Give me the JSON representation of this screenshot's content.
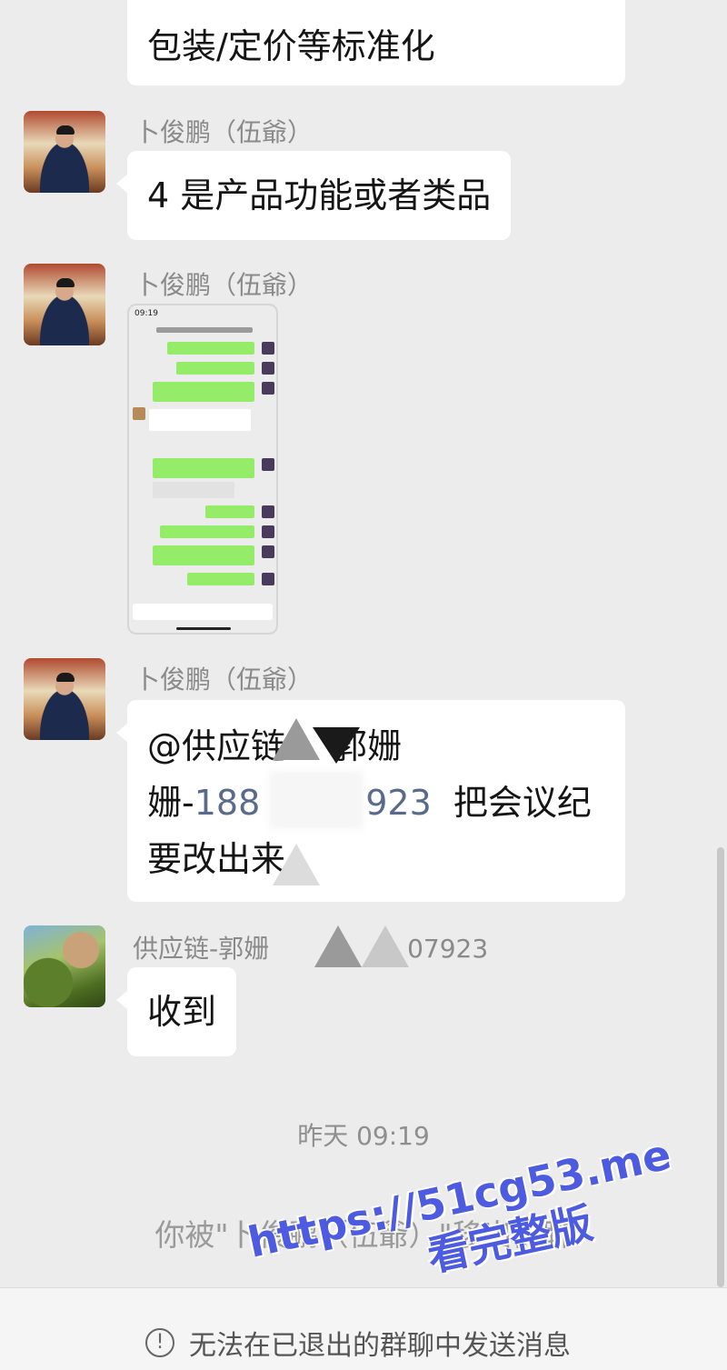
{
  "messages": {
    "m0": {
      "lines": [
        "包装/定价等标准化"
      ]
    },
    "m1": {
      "sender": "卜俊鹏（伍爺）",
      "text": "4 是产品功能或者类品"
    },
    "m2": {
      "sender": "卜俊鹏（伍爺）",
      "screenshot_time": "09:19"
    },
    "m3": {
      "sender": "卜俊鹏（伍爺）",
      "line1": "@供应链",
      "line1_tail": "郭姗",
      "line2_a": "姗-",
      "line2_num_a": "188",
      "line2_num_b": "923",
      "line2_b": "把会议纪",
      "line3": "要改出来"
    },
    "m4": {
      "sender_a": "供应链-郭姗",
      "sender_b": "07923",
      "text": "收到"
    }
  },
  "timestamp": "昨天 09:19",
  "system_note": "你被\"卜俊鹏（伍爺）\"移出群聊",
  "footer": {
    "icon": "info-circle-icon",
    "text": "无法在已退出的群聊中发送消息"
  },
  "watermark": {
    "line1": "https://51cg53.me",
    "line2": "看完整版"
  },
  "colors": {
    "background": "#ececec",
    "bubble": "#ffffff",
    "sent_bubble": "#95ec69",
    "watermark": "#4d5be0"
  }
}
